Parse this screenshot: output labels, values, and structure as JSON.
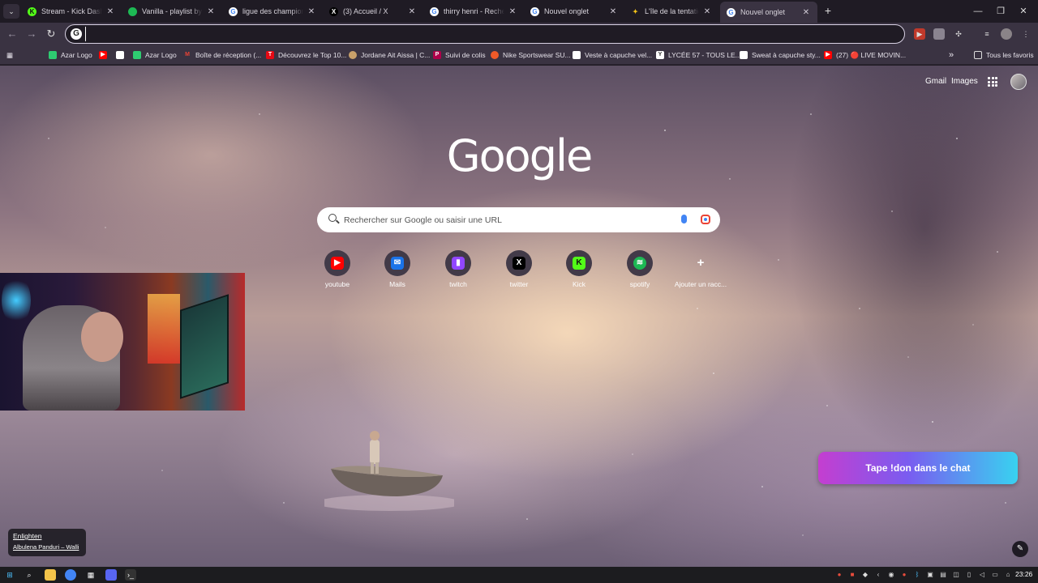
{
  "tabs": [
    {
      "title": "Stream - Kick Dashboard",
      "favicon_color": "#53fc18",
      "favicon_char": "K"
    },
    {
      "title": "Vanilla - playlist by Jo",
      "favicon_color": "#1db954",
      "favicon_char": ""
    },
    {
      "title": "ligue des champions",
      "favicon_color": "#ffffff",
      "favicon_char": "G"
    },
    {
      "title": "(3) Accueil / X",
      "favicon_color": "#000000",
      "favicon_char": "X"
    },
    {
      "title": "thirry henri - Recherche",
      "favicon_color": "#ffffff",
      "favicon_char": "G"
    },
    {
      "title": "Nouvel onglet",
      "favicon_color": "#ffffff",
      "favicon_char": "G"
    },
    {
      "title": "L'île de la tentation s",
      "favicon_color": "#f5c518",
      "favicon_char": "✦"
    },
    {
      "title": "Nouvel onglet",
      "favicon_color": "#ffffff",
      "favicon_char": "G",
      "active": true
    }
  ],
  "tab_close_glyph": "✕",
  "new_tab_glyph": "+",
  "window_controls": {
    "minimize": "—",
    "restore": "❐",
    "close": "✕"
  },
  "omnibox": {
    "value": ""
  },
  "bookmarks": [
    {
      "label": "Azar Logo",
      "color": "#2ecc71",
      "char": ""
    },
    {
      "label": "",
      "color": "#ff0000",
      "char": "▶"
    },
    {
      "label": "",
      "color": "#ffffff",
      "char": ""
    },
    {
      "label": "Azar Logo",
      "color": "#2ecc71",
      "char": ""
    },
    {
      "label": "Boîte de réception (...",
      "color": "#ea4335",
      "char": "M"
    },
    {
      "label": "Découvrez le Top 10...",
      "color": "#e50914",
      "char": "T"
    },
    {
      "label": "Jordane Ait Aissa | C...",
      "color": "#c8a06a",
      "char": ""
    },
    {
      "label": "Suivi de colis",
      "color": "#b0004a",
      "char": "P"
    },
    {
      "label": "Nike Sportswear SU...",
      "color": "#f05a28",
      "char": ""
    },
    {
      "label": "Veste à capuche vel...",
      "color": "#ffffff",
      "char": ""
    },
    {
      "label": "LYCÉE 57 - TOUS LE...",
      "color": "#ffffff",
      "char": "Y"
    },
    {
      "label": "Sweat à capuche sty...",
      "color": "#ffffff",
      "char": ""
    },
    {
      "label": "(27) 🔴 LIVE MOVIN...",
      "color": "#ff0000",
      "char": "▶"
    }
  ],
  "bookmarks_overflow": "»",
  "all_bookmarks": "Tous les favoris",
  "header_links": {
    "gmail": "Gmail",
    "images": "Images"
  },
  "logo_text": "Google",
  "search": {
    "placeholder": "Rechercher sur Google ou saisir une URL"
  },
  "shortcuts": [
    {
      "label": "youtube",
      "color": "#ff0000",
      "char": "▶"
    },
    {
      "label": "Mails",
      "color": "#1a73e8",
      "char": "✉"
    },
    {
      "label": "twitch",
      "color": "#9146ff",
      "char": "▮"
    },
    {
      "label": "twitter",
      "color": "#000000",
      "char": "X"
    },
    {
      "label": "Kick",
      "color": "#53fc18",
      "char": "K"
    },
    {
      "label": "spotify",
      "color": "#1db954",
      "char": "≋"
    },
    {
      "label": "Ajouter un racc...",
      "color": "transparent",
      "char": "+"
    }
  ],
  "donate_banner": "Tape !don dans le chat",
  "now_playing": {
    "title": "Enlighten",
    "artist": "Albulena Panduri – Walli"
  },
  "edit_glyph": "✎",
  "taskbar": {
    "clock": "23:26"
  }
}
